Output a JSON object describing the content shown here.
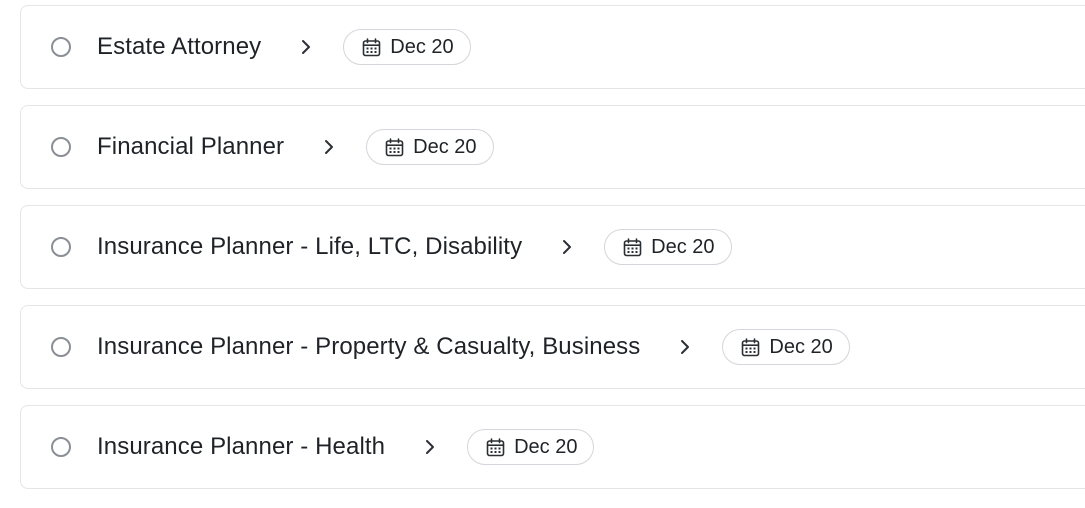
{
  "tasks": [
    {
      "title": "Estate Attorney",
      "date": "Dec 20",
      "completed": false
    },
    {
      "title": "Financial Planner",
      "date": "Dec 20",
      "completed": false
    },
    {
      "title": "Insurance Planner - Life, LTC, Disability",
      "date": "Dec 20",
      "completed": false
    },
    {
      "title": "Insurance Planner - Property & Casualty, Business",
      "date": "Dec 20",
      "completed": false
    },
    {
      "title": "Insurance Planner - Health",
      "date": "Dec 20",
      "completed": false
    }
  ],
  "icons": {
    "checkbox": "circle-checkbox-icon",
    "expand": "chevron-right-icon",
    "date": "calendar-icon"
  },
  "colors": {
    "border": "#e3e5e8",
    "text": "#1f2328",
    "checkbox": "#8a8f96"
  }
}
